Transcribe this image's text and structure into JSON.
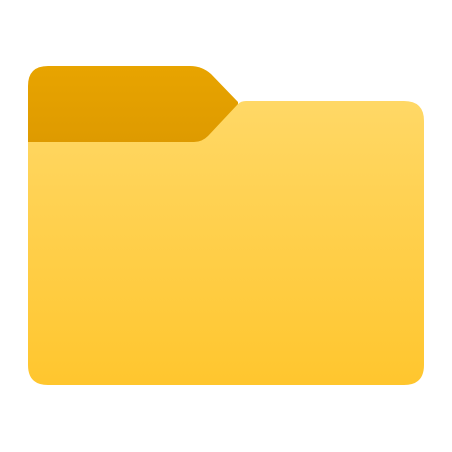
{
  "icon": {
    "name": "folder-icon",
    "colors": {
      "tab_top": "#E8A400",
      "tab_bottom": "#C98600",
      "body_top": "#FFD866",
      "body_bottom": "#FFC62E"
    }
  }
}
